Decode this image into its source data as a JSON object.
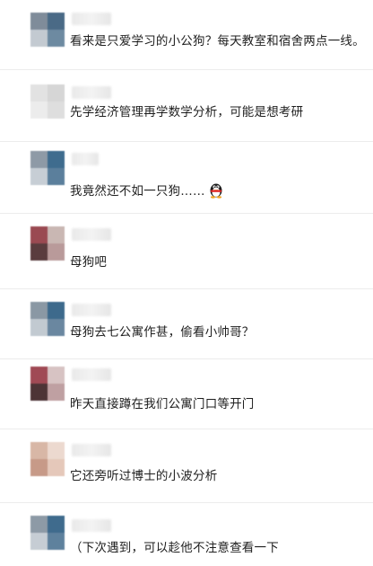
{
  "comments": [
    {
      "text": "看来是只爱学习的小公狗？每天教室和宿舍两点一线。",
      "avatar_colors": [
        "#7f8c9a",
        "#4a6a86",
        "#c3cad1",
        "#6d8aa1"
      ]
    },
    {
      "text": "先学经济管理再学数学分析，可能是想考研",
      "avatar_colors": [
        "#e2e2e2",
        "#d6d6d6",
        "#ececec",
        "#dedede"
      ]
    },
    {
      "text": "我竟然还不如一只狗……",
      "emoji": "qq-penguin-icon",
      "avatar_colors": [
        "#8e9aa6",
        "#3f6c8e",
        "#c7ced5",
        "#5b7f9c"
      ]
    },
    {
      "text": "母狗吧",
      "avatar_colors": [
        "#9a4a52",
        "#c9b7b3",
        "#5a3c3e",
        "#b99a9a"
      ]
    },
    {
      "text": "母狗去七公寓作甚，偷看小帅哥？",
      "avatar_colors": [
        "#8a98a4",
        "#3d6a8c",
        "#c2cad1",
        "#6a87a0"
      ]
    },
    {
      "text": "昨天直接蹲在我们公寓门口等开门",
      "avatar_colors": [
        "#a04a55",
        "#d7c3c3",
        "#4d3436",
        "#bfa0a2"
      ]
    },
    {
      "text": "它还旁听过博士的小波分析",
      "avatar_colors": [
        "#d8b7a6",
        "#ecd9cf",
        "#c79a88",
        "#e5c8ba"
      ]
    },
    {
      "text": "（下次遇到，可以趁他不注意查看一下",
      "avatar_colors": [
        "#8d9aa6",
        "#3f6b8d",
        "#c6cdd4",
        "#5e819d"
      ]
    }
  ]
}
